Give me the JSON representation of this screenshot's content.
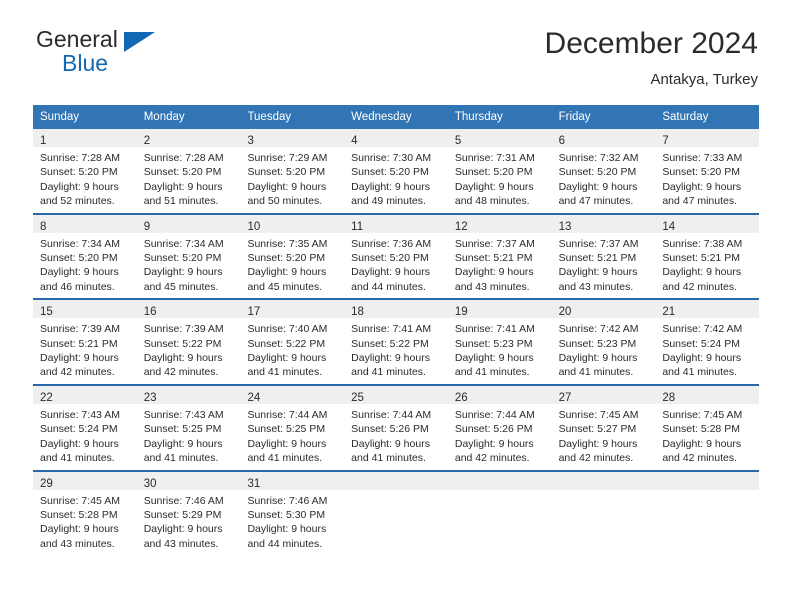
{
  "brand": {
    "name_part1": "General",
    "name_part2": "Blue",
    "triangle_color": "#1268b3",
    "text_color": "#2b2b2b"
  },
  "header": {
    "title": "December 2024",
    "location": "Antakya, Turkey"
  },
  "theme": {
    "header_blue": "#3275b4",
    "row_divider": "#2a6aa8",
    "day_band_gray": "#efefef",
    "text": "#2b2b2b"
  },
  "weekday_headers": [
    "Sunday",
    "Monday",
    "Tuesday",
    "Wednesday",
    "Thursday",
    "Friday",
    "Saturday"
  ],
  "weeks": [
    [
      {
        "day": "1",
        "sunrise": "Sunrise: 7:28 AM",
        "sunset": "Sunset: 5:20 PM",
        "daylight1": "Daylight: 9 hours",
        "daylight2": "and 52 minutes."
      },
      {
        "day": "2",
        "sunrise": "Sunrise: 7:28 AM",
        "sunset": "Sunset: 5:20 PM",
        "daylight1": "Daylight: 9 hours",
        "daylight2": "and 51 minutes."
      },
      {
        "day": "3",
        "sunrise": "Sunrise: 7:29 AM",
        "sunset": "Sunset: 5:20 PM",
        "daylight1": "Daylight: 9 hours",
        "daylight2": "and 50 minutes."
      },
      {
        "day": "4",
        "sunrise": "Sunrise: 7:30 AM",
        "sunset": "Sunset: 5:20 PM",
        "daylight1": "Daylight: 9 hours",
        "daylight2": "and 49 minutes."
      },
      {
        "day": "5",
        "sunrise": "Sunrise: 7:31 AM",
        "sunset": "Sunset: 5:20 PM",
        "daylight1": "Daylight: 9 hours",
        "daylight2": "and 48 minutes."
      },
      {
        "day": "6",
        "sunrise": "Sunrise: 7:32 AM",
        "sunset": "Sunset: 5:20 PM",
        "daylight1": "Daylight: 9 hours",
        "daylight2": "and 47 minutes."
      },
      {
        "day": "7",
        "sunrise": "Sunrise: 7:33 AM",
        "sunset": "Sunset: 5:20 PM",
        "daylight1": "Daylight: 9 hours",
        "daylight2": "and 47 minutes."
      }
    ],
    [
      {
        "day": "8",
        "sunrise": "Sunrise: 7:34 AM",
        "sunset": "Sunset: 5:20 PM",
        "daylight1": "Daylight: 9 hours",
        "daylight2": "and 46 minutes."
      },
      {
        "day": "9",
        "sunrise": "Sunrise: 7:34 AM",
        "sunset": "Sunset: 5:20 PM",
        "daylight1": "Daylight: 9 hours",
        "daylight2": "and 45 minutes."
      },
      {
        "day": "10",
        "sunrise": "Sunrise: 7:35 AM",
        "sunset": "Sunset: 5:20 PM",
        "daylight1": "Daylight: 9 hours",
        "daylight2": "and 45 minutes."
      },
      {
        "day": "11",
        "sunrise": "Sunrise: 7:36 AM",
        "sunset": "Sunset: 5:20 PM",
        "daylight1": "Daylight: 9 hours",
        "daylight2": "and 44 minutes."
      },
      {
        "day": "12",
        "sunrise": "Sunrise: 7:37 AM",
        "sunset": "Sunset: 5:21 PM",
        "daylight1": "Daylight: 9 hours",
        "daylight2": "and 43 minutes."
      },
      {
        "day": "13",
        "sunrise": "Sunrise: 7:37 AM",
        "sunset": "Sunset: 5:21 PM",
        "daylight1": "Daylight: 9 hours",
        "daylight2": "and 43 minutes."
      },
      {
        "day": "14",
        "sunrise": "Sunrise: 7:38 AM",
        "sunset": "Sunset: 5:21 PM",
        "daylight1": "Daylight: 9 hours",
        "daylight2": "and 42 minutes."
      }
    ],
    [
      {
        "day": "15",
        "sunrise": "Sunrise: 7:39 AM",
        "sunset": "Sunset: 5:21 PM",
        "daylight1": "Daylight: 9 hours",
        "daylight2": "and 42 minutes."
      },
      {
        "day": "16",
        "sunrise": "Sunrise: 7:39 AM",
        "sunset": "Sunset: 5:22 PM",
        "daylight1": "Daylight: 9 hours",
        "daylight2": "and 42 minutes."
      },
      {
        "day": "17",
        "sunrise": "Sunrise: 7:40 AM",
        "sunset": "Sunset: 5:22 PM",
        "daylight1": "Daylight: 9 hours",
        "daylight2": "and 41 minutes."
      },
      {
        "day": "18",
        "sunrise": "Sunrise: 7:41 AM",
        "sunset": "Sunset: 5:22 PM",
        "daylight1": "Daylight: 9 hours",
        "daylight2": "and 41 minutes."
      },
      {
        "day": "19",
        "sunrise": "Sunrise: 7:41 AM",
        "sunset": "Sunset: 5:23 PM",
        "daylight1": "Daylight: 9 hours",
        "daylight2": "and 41 minutes."
      },
      {
        "day": "20",
        "sunrise": "Sunrise: 7:42 AM",
        "sunset": "Sunset: 5:23 PM",
        "daylight1": "Daylight: 9 hours",
        "daylight2": "and 41 minutes."
      },
      {
        "day": "21",
        "sunrise": "Sunrise: 7:42 AM",
        "sunset": "Sunset: 5:24 PM",
        "daylight1": "Daylight: 9 hours",
        "daylight2": "and 41 minutes."
      }
    ],
    [
      {
        "day": "22",
        "sunrise": "Sunrise: 7:43 AM",
        "sunset": "Sunset: 5:24 PM",
        "daylight1": "Daylight: 9 hours",
        "daylight2": "and 41 minutes."
      },
      {
        "day": "23",
        "sunrise": "Sunrise: 7:43 AM",
        "sunset": "Sunset: 5:25 PM",
        "daylight1": "Daylight: 9 hours",
        "daylight2": "and 41 minutes."
      },
      {
        "day": "24",
        "sunrise": "Sunrise: 7:44 AM",
        "sunset": "Sunset: 5:25 PM",
        "daylight1": "Daylight: 9 hours",
        "daylight2": "and 41 minutes."
      },
      {
        "day": "25",
        "sunrise": "Sunrise: 7:44 AM",
        "sunset": "Sunset: 5:26 PM",
        "daylight1": "Daylight: 9 hours",
        "daylight2": "and 41 minutes."
      },
      {
        "day": "26",
        "sunrise": "Sunrise: 7:44 AM",
        "sunset": "Sunset: 5:26 PM",
        "daylight1": "Daylight: 9 hours",
        "daylight2": "and 42 minutes."
      },
      {
        "day": "27",
        "sunrise": "Sunrise: 7:45 AM",
        "sunset": "Sunset: 5:27 PM",
        "daylight1": "Daylight: 9 hours",
        "daylight2": "and 42 minutes."
      },
      {
        "day": "28",
        "sunrise": "Sunrise: 7:45 AM",
        "sunset": "Sunset: 5:28 PM",
        "daylight1": "Daylight: 9 hours",
        "daylight2": "and 42 minutes."
      }
    ],
    [
      {
        "day": "29",
        "sunrise": "Sunrise: 7:45 AM",
        "sunset": "Sunset: 5:28 PM",
        "daylight1": "Daylight: 9 hours",
        "daylight2": "and 43 minutes."
      },
      {
        "day": "30",
        "sunrise": "Sunrise: 7:46 AM",
        "sunset": "Sunset: 5:29 PM",
        "daylight1": "Daylight: 9 hours",
        "daylight2": "and 43 minutes."
      },
      {
        "day": "31",
        "sunrise": "Sunrise: 7:46 AM",
        "sunset": "Sunset: 5:30 PM",
        "daylight1": "Daylight: 9 hours",
        "daylight2": "and 44 minutes."
      },
      {
        "day": "",
        "sunrise": "",
        "sunset": "",
        "daylight1": "",
        "daylight2": ""
      },
      {
        "day": "",
        "sunrise": "",
        "sunset": "",
        "daylight1": "",
        "daylight2": ""
      },
      {
        "day": "",
        "sunrise": "",
        "sunset": "",
        "daylight1": "",
        "daylight2": ""
      },
      {
        "day": "",
        "sunrise": "",
        "sunset": "",
        "daylight1": "",
        "daylight2": ""
      }
    ]
  ]
}
